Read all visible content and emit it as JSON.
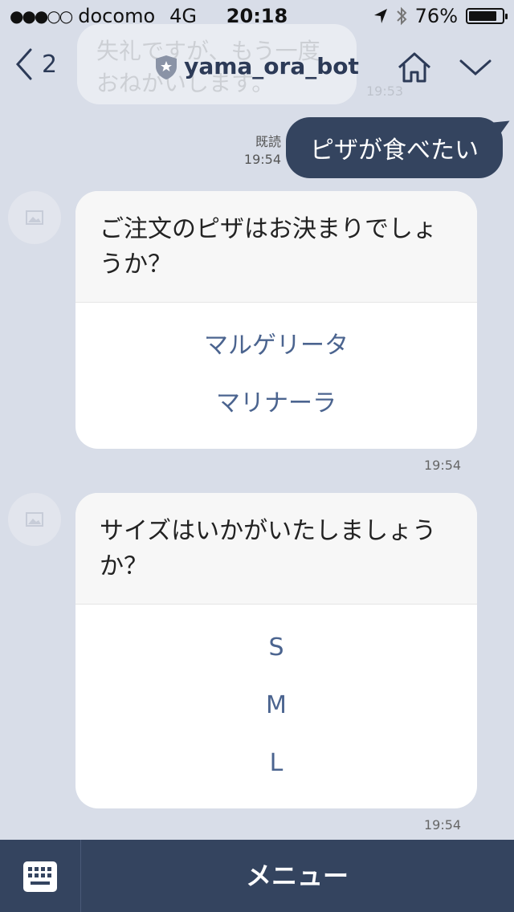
{
  "status": {
    "carrier": "docomo",
    "network": "4G",
    "time": "20:18",
    "battery": "76%"
  },
  "nav": {
    "back_count": "2",
    "title": "yama_ora_bot"
  },
  "ghost_message": {
    "line1": "失礼ですが、もう一度",
    "line2": "おねがいします。",
    "time": "19:53"
  },
  "sent_message": {
    "read_label": "既読",
    "time": "19:54",
    "text": "ピザが食べたい"
  },
  "cards": [
    {
      "question": "ご注文のピザはお決まりでしょうか？",
      "options": [
        "マルゲリータ",
        "マリナーラ"
      ],
      "time": "19:54"
    },
    {
      "question": "サイズはいかがいたしましょうか？",
      "options": [
        "S",
        "M",
        "L"
      ],
      "time": "19:54"
    }
  ],
  "bottom": {
    "menu_label": "メニュー"
  },
  "colors": {
    "background": "#d8dde8",
    "navy": "#34445f",
    "option_text": "#4b648f"
  }
}
